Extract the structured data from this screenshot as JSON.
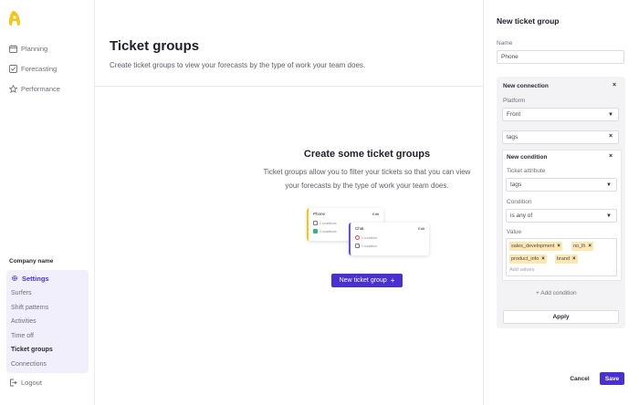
{
  "sidebar": {
    "logo_color": "#f5c518",
    "nav": [
      {
        "label": "Planning",
        "icon": "calendar-icon"
      },
      {
        "label": "Forecasting",
        "icon": "checkbox-icon"
      },
      {
        "label": "Performance",
        "icon": "star-icon"
      }
    ],
    "company_label": "Company name",
    "settings_label": "Settings",
    "settings_items": [
      "Surfers",
      "Shift patterns",
      "Activities",
      "Time off",
      "Ticket groups",
      "Connections"
    ],
    "active_item": "Ticket groups",
    "logout_label": "Logout"
  },
  "main": {
    "title": "Ticket groups",
    "subtitle": "Create ticket groups to view your forecasts by the type of work your team does.",
    "empty_title": "Create some ticket groups",
    "empty_text": "Ticket groups allow you to filter your tickets so that you can view your forecasts by the type of work your team does.",
    "illustration": {
      "card1_title": "Phone",
      "card1_edit": "Edit",
      "card1_rows": [
        "2 conditions",
        "2 conditions"
      ],
      "card2_title": "Chat",
      "card2_edit": "Edit",
      "card2_rows": [
        "1 condition",
        "1 condition"
      ]
    },
    "new_button_label": "New ticket group",
    "new_button_icon": "+"
  },
  "panel": {
    "title": "New ticket group",
    "name_label": "Name",
    "name_value": "Phone",
    "connection_title": "New connection",
    "platform_label": "Platform",
    "platform_value": "Front",
    "tags_value": "tags",
    "condition_title": "New condition",
    "attribute_label": "Ticket attribute",
    "attribute_value": "tags",
    "condition_label": "Condition",
    "condition_value": "is any of",
    "value_label": "Value",
    "tags": [
      "sales_development",
      "no_lh",
      "product_info",
      "brand"
    ],
    "add_values_placeholder": "Add values",
    "add_condition_label": "+ Add condition",
    "apply_label": "Apply",
    "cancel_label": "Cancel",
    "save_label": "Save",
    "accent_color": "#4a2fd1",
    "tag_color": "#fbe7b2"
  }
}
